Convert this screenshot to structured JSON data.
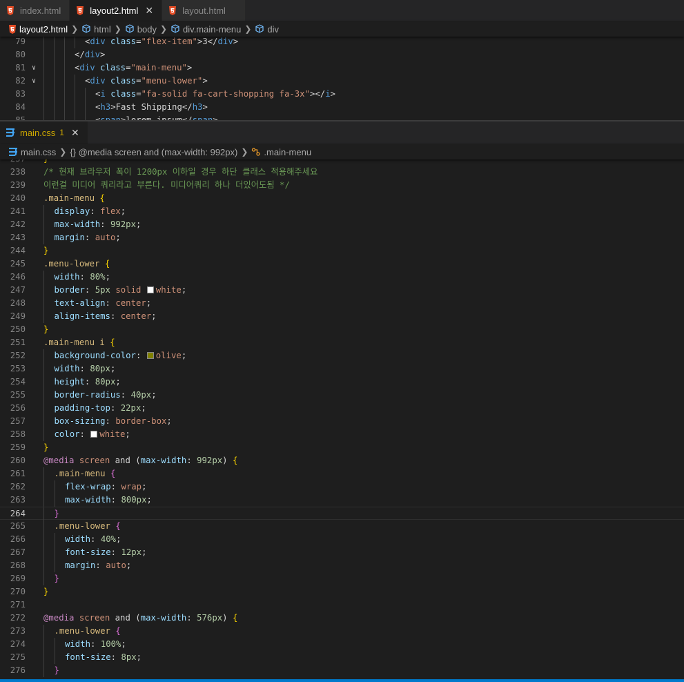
{
  "top_group": {
    "tabs": [
      {
        "label": "index.html",
        "active": false
      },
      {
        "label": "layout2.html",
        "active": true,
        "close": "✕"
      },
      {
        "label": "layout.html",
        "active": false
      }
    ],
    "breadcrumb": [
      "layout2.html",
      "html",
      "body",
      "div.main-menu",
      "div"
    ],
    "lines": [
      {
        "n": "79",
        "fold": false,
        "indent": 4,
        "tokens": [
          [
            "t",
            "<"
          ],
          [
            "tag",
            "div"
          ],
          [
            "t",
            " "
          ],
          [
            "attr",
            "class"
          ],
          [
            "t",
            "="
          ],
          [
            "str",
            "\"flex-item\""
          ],
          [
            "t",
            ">"
          ],
          [
            "txt",
            "3"
          ],
          [
            "t",
            "</"
          ],
          [
            "tag",
            "div"
          ],
          [
            "t",
            ">"
          ]
        ]
      },
      {
        "n": "80",
        "fold": false,
        "indent": 3,
        "tokens": [
          [
            "t",
            "</"
          ],
          [
            "tag",
            "div"
          ],
          [
            "t",
            ">"
          ]
        ]
      },
      {
        "n": "81",
        "fold": true,
        "indent": 3,
        "tokens": [
          [
            "t",
            "<"
          ],
          [
            "tag",
            "div"
          ],
          [
            "t",
            " "
          ],
          [
            "attr",
            "class"
          ],
          [
            "t",
            "="
          ],
          [
            "str",
            "\"main-menu\""
          ],
          [
            "t",
            ">"
          ]
        ]
      },
      {
        "n": "82",
        "fold": true,
        "indent": 4,
        "tokens": [
          [
            "t",
            "<"
          ],
          [
            "tag",
            "div"
          ],
          [
            "t",
            " "
          ],
          [
            "attr",
            "class"
          ],
          [
            "t",
            "="
          ],
          [
            "str",
            "\"menu-lower\""
          ],
          [
            "t",
            ">"
          ]
        ]
      },
      {
        "n": "83",
        "fold": false,
        "indent": 5,
        "tokens": [
          [
            "t",
            "<"
          ],
          [
            "tag",
            "i"
          ],
          [
            "t",
            " "
          ],
          [
            "attr",
            "class"
          ],
          [
            "t",
            "="
          ],
          [
            "str",
            "\"fa-solid fa-cart-shopping fa-3x\""
          ],
          [
            "t",
            "></"
          ],
          [
            "tag",
            "i"
          ],
          [
            "t",
            ">"
          ]
        ]
      },
      {
        "n": "84",
        "fold": false,
        "indent": 5,
        "tokens": [
          [
            "t",
            "<"
          ],
          [
            "tag",
            "h3"
          ],
          [
            "t",
            ">"
          ],
          [
            "txt",
            "Fast Shipping"
          ],
          [
            "t",
            "</"
          ],
          [
            "tag",
            "h3"
          ],
          [
            "t",
            ">"
          ]
        ]
      },
      {
        "n": "85",
        "fold": false,
        "indent": 5,
        "tokens": [
          [
            "t",
            "<"
          ],
          [
            "tag",
            "span"
          ],
          [
            "t",
            ">"
          ],
          [
            "txt",
            "lorem ipsum"
          ],
          [
            "t",
            "</"
          ],
          [
            "tag",
            "span"
          ],
          [
            "t",
            ">"
          ]
        ]
      }
    ]
  },
  "bottom_group": {
    "tab": {
      "label": "main.css",
      "badge": "1",
      "close": "✕"
    },
    "breadcrumb": [
      "main.css",
      "{} @media screen and (max-width: 992px)",
      ".main-menu"
    ],
    "lines": [
      {
        "n": "237",
        "indent": 0,
        "tokens": [
          [
            "b1",
            "}"
          ]
        ]
      },
      {
        "n": "238",
        "indent": 0,
        "tokens": [
          [
            "cmt",
            "/* 현재 브라우저 폭이 1200px 이하일 경우 하단 클래스 적용해주세요"
          ]
        ]
      },
      {
        "n": "239",
        "indent": 0,
        "tokens": [
          [
            "cmt",
            "이런걸 미디어 쿼리라고 부른다. 미디어쿼리 하나 더있어도됨 */"
          ]
        ]
      },
      {
        "n": "240",
        "indent": 0,
        "tokens": [
          [
            "sel",
            ".main-menu"
          ],
          [
            "t",
            " "
          ],
          [
            "b1",
            "{"
          ]
        ]
      },
      {
        "n": "241",
        "indent": 1,
        "tokens": [
          [
            "prop",
            "display"
          ],
          [
            "t",
            ": "
          ],
          [
            "kw",
            "flex"
          ],
          [
            "t",
            ";"
          ]
        ]
      },
      {
        "n": "242",
        "indent": 1,
        "tokens": [
          [
            "prop",
            "max-width"
          ],
          [
            "t",
            ": "
          ],
          [
            "num",
            "992px"
          ],
          [
            "t",
            ";"
          ]
        ]
      },
      {
        "n": "243",
        "indent": 1,
        "tokens": [
          [
            "prop",
            "margin"
          ],
          [
            "t",
            ": "
          ],
          [
            "kw",
            "auto"
          ],
          [
            "t",
            ";"
          ]
        ]
      },
      {
        "n": "244",
        "indent": 0,
        "tokens": [
          [
            "b1",
            "}"
          ]
        ]
      },
      {
        "n": "245",
        "indent": 0,
        "tokens": [
          [
            "sel",
            ".menu-lower"
          ],
          [
            "t",
            " "
          ],
          [
            "b1",
            "{"
          ]
        ]
      },
      {
        "n": "246",
        "indent": 1,
        "tokens": [
          [
            "prop",
            "width"
          ],
          [
            "t",
            ": "
          ],
          [
            "num",
            "80%"
          ],
          [
            "t",
            ";"
          ]
        ]
      },
      {
        "n": "247",
        "indent": 1,
        "tokens": [
          [
            "prop",
            "border"
          ],
          [
            "t",
            ": "
          ],
          [
            "num",
            "5px"
          ],
          [
            "t",
            " "
          ],
          [
            "kw",
            "solid"
          ],
          [
            "t",
            " "
          ],
          [
            "swatch",
            "#ffffff"
          ],
          [
            "kw",
            "white"
          ],
          [
            "t",
            ";"
          ]
        ]
      },
      {
        "n": "248",
        "indent": 1,
        "tokens": [
          [
            "prop",
            "text-align"
          ],
          [
            "t",
            ": "
          ],
          [
            "kw",
            "center"
          ],
          [
            "t",
            ";"
          ]
        ]
      },
      {
        "n": "249",
        "indent": 1,
        "tokens": [
          [
            "prop",
            "align-items"
          ],
          [
            "t",
            ": "
          ],
          [
            "kw",
            "center"
          ],
          [
            "t",
            ";"
          ]
        ]
      },
      {
        "n": "250",
        "indent": 0,
        "tokens": [
          [
            "b1",
            "}"
          ]
        ]
      },
      {
        "n": "251",
        "indent": 0,
        "tokens": [
          [
            "sel",
            ".main-menu i"
          ],
          [
            "t",
            " "
          ],
          [
            "b1",
            "{"
          ]
        ]
      },
      {
        "n": "252",
        "indent": 1,
        "tokens": [
          [
            "prop",
            "background-color"
          ],
          [
            "t",
            ": "
          ],
          [
            "swatch",
            "#808000"
          ],
          [
            "kw",
            "olive"
          ],
          [
            "t",
            ";"
          ]
        ]
      },
      {
        "n": "253",
        "indent": 1,
        "tokens": [
          [
            "prop",
            "width"
          ],
          [
            "t",
            ": "
          ],
          [
            "num",
            "80px"
          ],
          [
            "t",
            ";"
          ]
        ]
      },
      {
        "n": "254",
        "indent": 1,
        "tokens": [
          [
            "prop",
            "height"
          ],
          [
            "t",
            ": "
          ],
          [
            "num",
            "80px"
          ],
          [
            "t",
            ";"
          ]
        ]
      },
      {
        "n": "255",
        "indent": 1,
        "tokens": [
          [
            "prop",
            "border-radius"
          ],
          [
            "t",
            ": "
          ],
          [
            "num",
            "40px"
          ],
          [
            "t",
            ";"
          ]
        ]
      },
      {
        "n": "256",
        "indent": 1,
        "tokens": [
          [
            "prop",
            "padding-top"
          ],
          [
            "t",
            ": "
          ],
          [
            "num",
            "22px"
          ],
          [
            "t",
            ";"
          ]
        ]
      },
      {
        "n": "257",
        "indent": 1,
        "tokens": [
          [
            "prop",
            "box-sizing"
          ],
          [
            "t",
            ": "
          ],
          [
            "kw",
            "border-box"
          ],
          [
            "t",
            ";"
          ]
        ]
      },
      {
        "n": "258",
        "indent": 1,
        "tokens": [
          [
            "prop",
            "color"
          ],
          [
            "t",
            ": "
          ],
          [
            "swatch",
            "#ffffff"
          ],
          [
            "kw",
            "white"
          ],
          [
            "t",
            ";"
          ]
        ]
      },
      {
        "n": "259",
        "indent": 0,
        "tokens": [
          [
            "b1",
            "}"
          ]
        ]
      },
      {
        "n": "260",
        "indent": 0,
        "tokens": [
          [
            "at",
            "@media"
          ],
          [
            "t",
            " "
          ],
          [
            "kw",
            "screen"
          ],
          [
            "t",
            " and ("
          ],
          [
            "prop",
            "max-width"
          ],
          [
            "t",
            ": "
          ],
          [
            "num",
            "992px"
          ],
          [
            "t",
            ") "
          ],
          [
            "b1",
            "{"
          ]
        ]
      },
      {
        "n": "261",
        "indent": 1,
        "tokens": [
          [
            "sel",
            ".main-menu"
          ],
          [
            "t",
            " "
          ],
          [
            "b2",
            "{"
          ]
        ]
      },
      {
        "n": "262",
        "indent": 2,
        "tokens": [
          [
            "prop",
            "flex-wrap"
          ],
          [
            "t",
            ": "
          ],
          [
            "kw",
            "wrap"
          ],
          [
            "t",
            ";"
          ]
        ]
      },
      {
        "n": "263",
        "indent": 2,
        "tokens": [
          [
            "prop",
            "max-width"
          ],
          [
            "t",
            ": "
          ],
          [
            "num",
            "800px"
          ],
          [
            "t",
            ";"
          ]
        ]
      },
      {
        "n": "264",
        "indent": 1,
        "current": true,
        "tokens": [
          [
            "b2",
            "}"
          ]
        ]
      },
      {
        "n": "265",
        "indent": 1,
        "tokens": [
          [
            "sel",
            ".menu-lower"
          ],
          [
            "t",
            " "
          ],
          [
            "b2",
            "{"
          ]
        ]
      },
      {
        "n": "266",
        "indent": 2,
        "tokens": [
          [
            "prop",
            "width"
          ],
          [
            "t",
            ": "
          ],
          [
            "num",
            "40%"
          ],
          [
            "t",
            ";"
          ]
        ]
      },
      {
        "n": "267",
        "indent": 2,
        "tokens": [
          [
            "prop",
            "font-size"
          ],
          [
            "t",
            ": "
          ],
          [
            "num",
            "12px"
          ],
          [
            "t",
            ";"
          ]
        ]
      },
      {
        "n": "268",
        "indent": 2,
        "tokens": [
          [
            "prop",
            "margin"
          ],
          [
            "t",
            ": "
          ],
          [
            "kw",
            "auto"
          ],
          [
            "t",
            ";"
          ]
        ]
      },
      {
        "n": "269",
        "indent": 1,
        "tokens": [
          [
            "b2",
            "}"
          ]
        ]
      },
      {
        "n": "270",
        "indent": 0,
        "tokens": [
          [
            "b1",
            "}"
          ]
        ]
      },
      {
        "n": "271",
        "indent": 0,
        "tokens": []
      },
      {
        "n": "272",
        "indent": 0,
        "tokens": [
          [
            "at",
            "@media"
          ],
          [
            "t",
            " "
          ],
          [
            "kw",
            "screen"
          ],
          [
            "t",
            " and ("
          ],
          [
            "prop",
            "max-width"
          ],
          [
            "t",
            ": "
          ],
          [
            "num",
            "576px"
          ],
          [
            "t",
            ") "
          ],
          [
            "b1",
            "{"
          ]
        ]
      },
      {
        "n": "273",
        "indent": 1,
        "tokens": [
          [
            "sel",
            ".menu-lower"
          ],
          [
            "t",
            " "
          ],
          [
            "b2",
            "{"
          ]
        ]
      },
      {
        "n": "274",
        "indent": 2,
        "tokens": [
          [
            "prop",
            "width"
          ],
          [
            "t",
            ": "
          ],
          [
            "num",
            "100%"
          ],
          [
            "t",
            ";"
          ]
        ]
      },
      {
        "n": "275",
        "indent": 2,
        "tokens": [
          [
            "prop",
            "font-size"
          ],
          [
            "t",
            ": "
          ],
          [
            "num",
            "8px"
          ],
          [
            "t",
            ";"
          ]
        ]
      },
      {
        "n": "276",
        "indent": 1,
        "tokens": [
          [
            "b2",
            "}"
          ]
        ]
      }
    ]
  },
  "colors": {
    "accent": "#007acc",
    "html_icon": "#e44d26",
    "css_icon": "#42a5f5",
    "badge": "#cca700"
  },
  "icons": {
    "html_file": "html5-icon",
    "css_file": "css3-icon",
    "element": "cube-icon",
    "braces": "braces-icon",
    "selector": "selector-icon"
  }
}
